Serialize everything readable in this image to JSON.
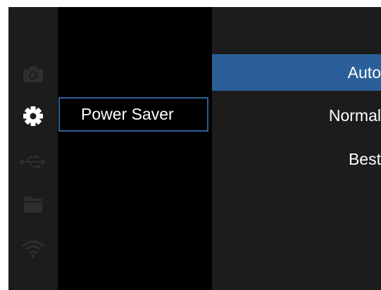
{
  "sidebar": {
    "icons": [
      {
        "name": "camera-icon",
        "active": false
      },
      {
        "name": "gear-icon",
        "active": true
      },
      {
        "name": "usb-icon",
        "active": false
      },
      {
        "name": "folder-icon",
        "active": false
      },
      {
        "name": "wifi-icon",
        "active": false
      }
    ]
  },
  "menu": {
    "items": [
      {
        "label": "Power Saver"
      }
    ]
  },
  "submenu": {
    "options": [
      {
        "label": "Auto",
        "selected": true
      },
      {
        "label": "Normal",
        "selected": false
      },
      {
        "label": "Best",
        "selected": false
      }
    ]
  },
  "colors": {
    "accent": "#2b5f99",
    "panel": "#1c1c1c",
    "background": "#000000",
    "icon_inactive": "#2e2e2e",
    "icon_active": "#ffffff"
  }
}
